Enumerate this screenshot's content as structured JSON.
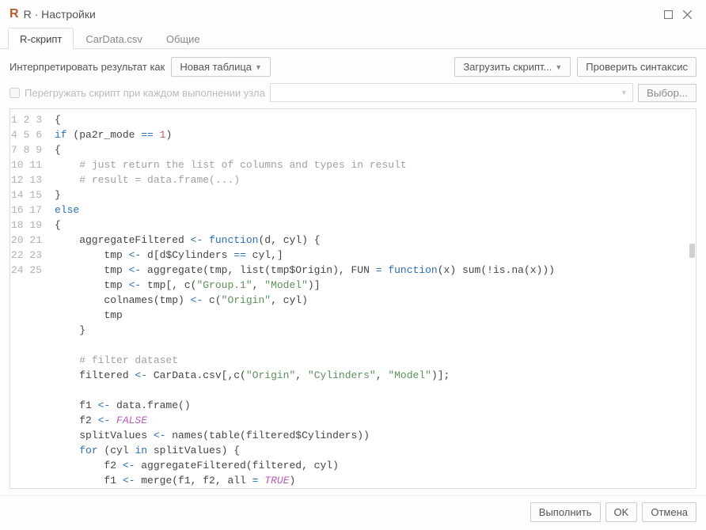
{
  "window": {
    "app_icon_letter": "R",
    "title": "R · Настройки"
  },
  "tabs": [
    {
      "label": "R-скрипт",
      "active": true
    },
    {
      "label": "CarData.csv",
      "active": false
    },
    {
      "label": "Общие",
      "active": false
    }
  ],
  "toolbar": {
    "interpret_label": "Интерпретировать результат как",
    "result_mode": "Новая таблица",
    "load_script": "Загрузить скрипт...",
    "check_syntax": "Проверить синтаксис"
  },
  "reload": {
    "checkbox_label": "Перегружать скрипт при каждом выполнении узла",
    "select_button": "Выбор..."
  },
  "code_lines": [
    {
      "n": 1,
      "html": "{"
    },
    {
      "n": 2,
      "html": "<span class='tok-kw'>if</span> (pa2r_mode <span class='tok-op'>==</span> <span class='tok-num'>1</span>)"
    },
    {
      "n": 3,
      "html": "{"
    },
    {
      "n": 4,
      "html": "    <span class='tok-com'># just return the list of columns and types in result</span>"
    },
    {
      "n": 5,
      "html": "    <span class='tok-com'># result = data.frame(...)</span>"
    },
    {
      "n": 6,
      "html": "}"
    },
    {
      "n": 7,
      "html": "<span class='tok-kw'>else</span>"
    },
    {
      "n": 8,
      "html": "{"
    },
    {
      "n": 9,
      "html": "    aggregateFiltered <span class='tok-op'>&lt;-</span> <span class='tok-kw'>function</span>(d, cyl) {"
    },
    {
      "n": 10,
      "html": "        tmp <span class='tok-op'>&lt;-</span> d[d$Cylinders <span class='tok-op'>==</span> cyl,]"
    },
    {
      "n": 11,
      "html": "        tmp <span class='tok-op'>&lt;-</span> aggregate(tmp, list(tmp$Origin), FUN <span class='tok-op'>=</span> <span class='tok-kw'>function</span>(x) sum(!is.na(x)))"
    },
    {
      "n": 12,
      "html": "        tmp <span class='tok-op'>&lt;-</span> tmp[, c(<span class='tok-str'>\"Group.1\"</span>, <span class='tok-str'>\"Model\"</span>)]"
    },
    {
      "n": 13,
      "html": "        colnames(tmp) <span class='tok-op'>&lt;-</span> c(<span class='tok-str'>\"Origin\"</span>, cyl)"
    },
    {
      "n": 14,
      "html": "        tmp"
    },
    {
      "n": 15,
      "html": "    }"
    },
    {
      "n": 16,
      "html": ""
    },
    {
      "n": 17,
      "html": "    <span class='tok-com'># filter dataset</span>"
    },
    {
      "n": 18,
      "html": "    filtered <span class='tok-op'>&lt;-</span> CarData.csv[,c(<span class='tok-str'>\"Origin\"</span>, <span class='tok-str'>\"Cylinders\"</span>, <span class='tok-str'>\"Model\"</span>)];"
    },
    {
      "n": 19,
      "html": ""
    },
    {
      "n": 20,
      "html": "    f1 <span class='tok-op'>&lt;-</span> data.frame()"
    },
    {
      "n": 21,
      "html": "    f2 <span class='tok-op'>&lt;-</span> <span class='tok-bool'>FALSE</span>"
    },
    {
      "n": 22,
      "html": "    splitValues <span class='tok-op'>&lt;-</span> names(table(filtered$Cylinders))"
    },
    {
      "n": 23,
      "html": "    <span class='tok-kw'>for</span> (cyl <span class='tok-kw'>in</span> splitValues) {"
    },
    {
      "n": 24,
      "html": "        f2 <span class='tok-op'>&lt;-</span> aggregateFiltered(filtered, cyl)"
    },
    {
      "n": 25,
      "html": "        f1 <span class='tok-op'>&lt;-</span> merge(f1, f2, all <span class='tok-op'>=</span> <span class='tok-bool'>TRUE</span>)"
    }
  ],
  "footer": {
    "run": "Выполнить",
    "ok": "OK",
    "cancel": "Отмена"
  }
}
